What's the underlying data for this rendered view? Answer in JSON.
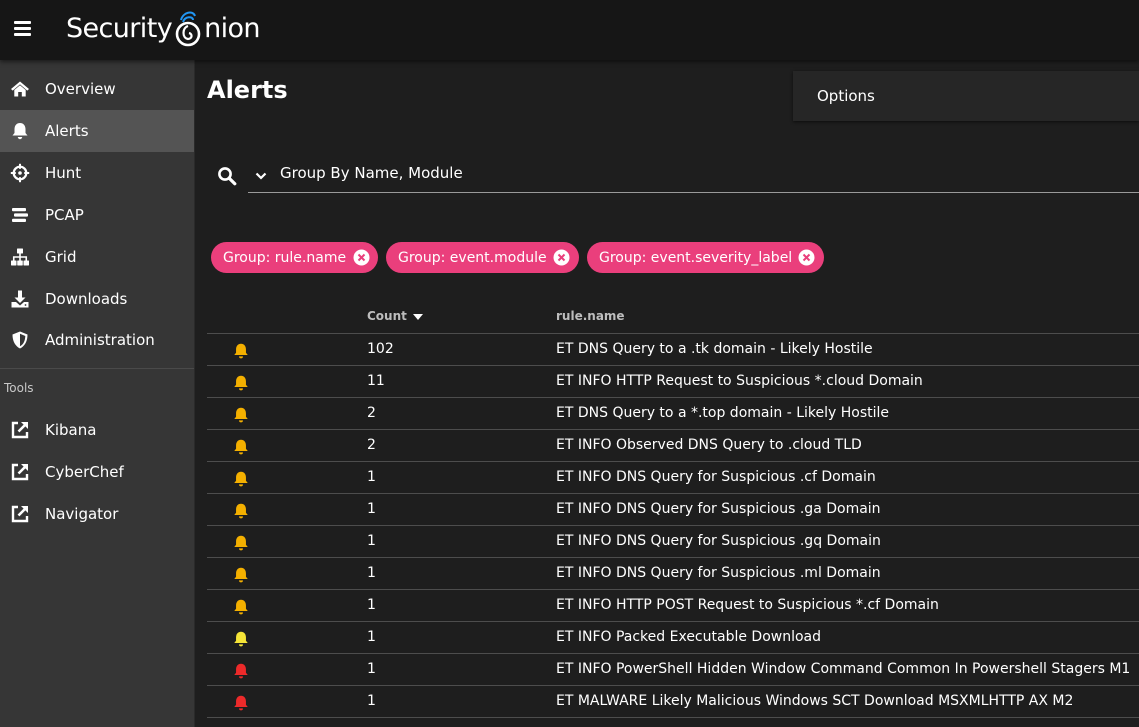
{
  "app": {
    "brand_left": "Security",
    "brand_right": "nion",
    "logo_color": "#2196f3"
  },
  "sidebar": {
    "items": [
      {
        "label": "Overview",
        "icon": "home-icon",
        "active": false
      },
      {
        "label": "Alerts",
        "icon": "bell-icon",
        "active": true
      },
      {
        "label": "Hunt",
        "icon": "crosshairs-icon",
        "active": false
      },
      {
        "label": "PCAP",
        "icon": "stream-icon",
        "active": false
      },
      {
        "label": "Grid",
        "icon": "sitemap-icon",
        "active": false
      },
      {
        "label": "Downloads",
        "icon": "download-icon",
        "active": false
      },
      {
        "label": "Administration",
        "icon": "shield-icon",
        "active": false
      }
    ],
    "tools_header": "Tools",
    "tools": [
      {
        "label": "Kibana",
        "icon": "external-link-icon"
      },
      {
        "label": "CyberChef",
        "icon": "external-link-icon"
      },
      {
        "label": "Navigator",
        "icon": "external-link-icon"
      }
    ]
  },
  "main": {
    "title": "Alerts",
    "options_label": "Options",
    "query": "Group By Name, Module",
    "chips": [
      {
        "label": "Group: rule.name"
      },
      {
        "label": "Group: event.module"
      },
      {
        "label": "Group: event.severity_label"
      }
    ],
    "columns": {
      "count": "Count",
      "rule": "rule.name"
    },
    "rows": [
      {
        "count": "102",
        "rule": "ET DNS Query to a .tk domain - Likely Hostile",
        "severity": "medium"
      },
      {
        "count": "11",
        "rule": "ET INFO HTTP Request to Suspicious *.cloud Domain",
        "severity": "medium"
      },
      {
        "count": "2",
        "rule": "ET DNS Query to a *.top domain - Likely Hostile",
        "severity": "medium"
      },
      {
        "count": "2",
        "rule": "ET INFO Observed DNS Query to .cloud TLD",
        "severity": "medium"
      },
      {
        "count": "1",
        "rule": "ET INFO DNS Query for Suspicious .cf Domain",
        "severity": "medium"
      },
      {
        "count": "1",
        "rule": "ET INFO DNS Query for Suspicious .ga Domain",
        "severity": "medium"
      },
      {
        "count": "1",
        "rule": "ET INFO DNS Query for Suspicious .gq Domain",
        "severity": "medium"
      },
      {
        "count": "1",
        "rule": "ET INFO DNS Query for Suspicious .ml Domain",
        "severity": "medium"
      },
      {
        "count": "1",
        "rule": "ET INFO HTTP POST Request to Suspicious *.cf Domain",
        "severity": "medium"
      },
      {
        "count": "1",
        "rule": "ET INFO Packed Executable Download",
        "severity": "low"
      },
      {
        "count": "1",
        "rule": "ET INFO PowerShell Hidden Window Command Common In Powershell Stagers M1",
        "severity": "high"
      },
      {
        "count": "1",
        "rule": "ET MALWARE Likely Malicious Windows SCT Download MSXMLHTTP AX M2",
        "severity": "high"
      }
    ]
  },
  "colors": {
    "chip": "#ea3f7c",
    "severity_medium": "#f4b000",
    "severity_low": "#f5e437",
    "severity_high": "#ed2a2a",
    "active_nav": "#545454"
  }
}
